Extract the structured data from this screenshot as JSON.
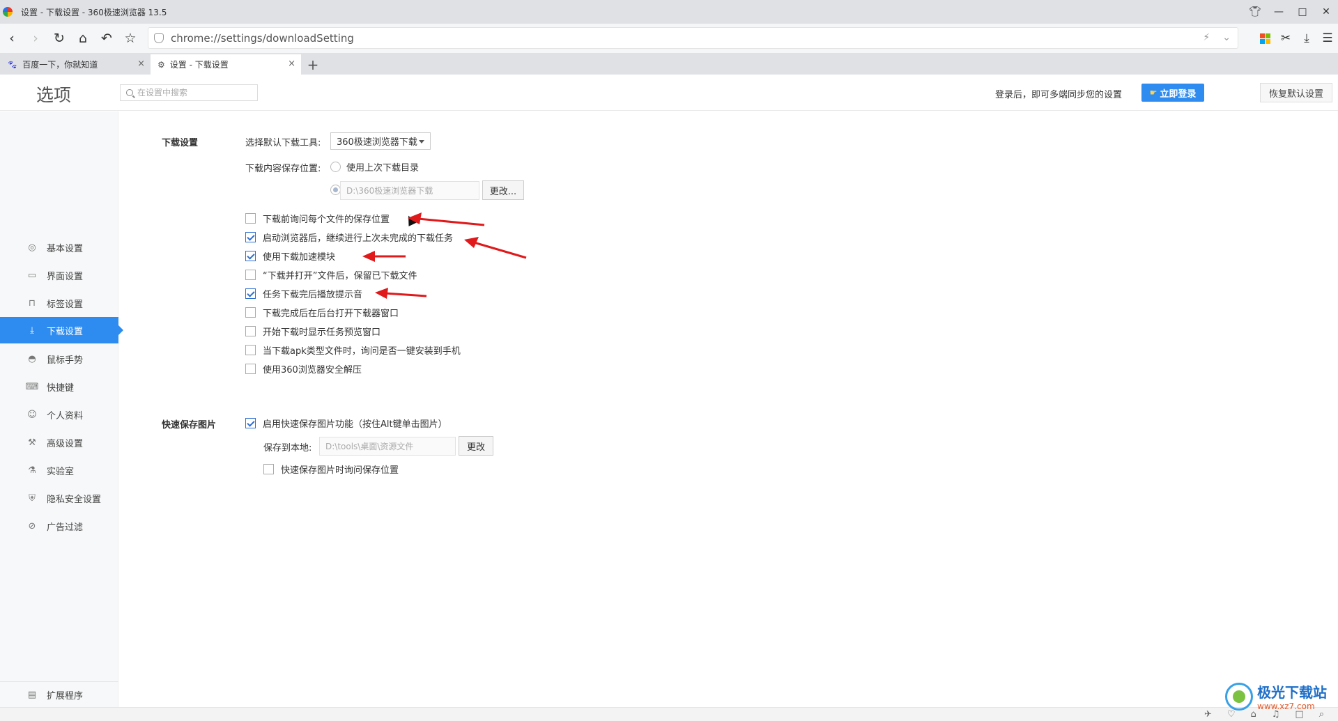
{
  "window": {
    "title": "设置 - 下载设置 - 360极速浏览器 13.5"
  },
  "address_bar": {
    "url": "chrome://settings/downloadSetting"
  },
  "tabs": [
    {
      "label": "百度一下，你就知道",
      "close": "×"
    },
    {
      "label": "设置 - 下载设置",
      "close": "×"
    }
  ],
  "header": {
    "title": "选项",
    "search_placeholder": "在设置中搜索",
    "login_hint": "登录后，即可多端同步您的设置",
    "login_button": "立即登录",
    "restore_button": "恢复默认设置"
  },
  "sidebar": {
    "items": [
      {
        "label": "基本设置"
      },
      {
        "label": "界面设置"
      },
      {
        "label": "标签设置"
      },
      {
        "label": "下载设置"
      },
      {
        "label": "鼠标手势"
      },
      {
        "label": "快捷键"
      },
      {
        "label": "个人资料"
      },
      {
        "label": "高级设置"
      },
      {
        "label": "实验室"
      },
      {
        "label": "隐私安全设置"
      },
      {
        "label": "广告过滤"
      }
    ],
    "active_item": "下载设置",
    "extensions": "扩展程序"
  },
  "download": {
    "section_title": "下载设置",
    "tool_label": "选择默认下载工具:",
    "tool_value": "360极速浏览器下载",
    "save_location_label": "下载内容保存位置:",
    "use_last_dir": "使用上次下载目录",
    "save_path": "D:\\360极速浏览器下载",
    "change_button": "更改...",
    "options": [
      {
        "label": "下载前询问每个文件的保存位置",
        "checked": false
      },
      {
        "label": "启动浏览器后，继续进行上次未完成的下载任务",
        "checked": true
      },
      {
        "label": "使用下载加速模块",
        "checked": true
      },
      {
        "label": "“下载并打开”文件后，保留已下载文件",
        "checked": false
      },
      {
        "label": "任务下载完后播放提示音",
        "checked": true
      },
      {
        "label": "下载完成后在后台打开下载器窗口",
        "checked": false
      },
      {
        "label": "开始下载时显示任务预览窗口",
        "checked": false
      },
      {
        "label": "当下载apk类型文件时，询问是否一键安装到手机",
        "checked": false
      },
      {
        "label": "使用360浏览器安全解压",
        "checked": false
      }
    ]
  },
  "quick_save": {
    "section_title": "快速保存图片",
    "enable_label": "启用快速保存图片功能（按住Alt键单击图片）",
    "enable_checked": true,
    "save_local_label": "保存到本地:",
    "save_local_path": "D:\\tools\\桌面\\资源文件",
    "change_button": "更改",
    "ask_location_label": "快速保存图片时询问保存位置",
    "ask_location_checked": false
  },
  "watermark": {
    "name": "极光下载站",
    "url": "www.xz7.com"
  },
  "colors": {
    "accent": "#2e8cf0",
    "annotation_arrow": "#e0191b",
    "checkbox_check": "#2e6fd1"
  }
}
